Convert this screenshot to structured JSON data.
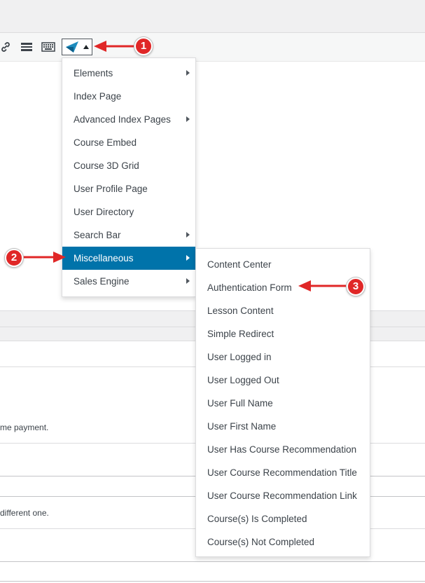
{
  "toolbar": {
    "icons": [
      "link-icon",
      "horizontal-rule-icon",
      "keyboard-icon",
      "plugin-logo-icon",
      "caret-up-icon"
    ]
  },
  "background": {
    "text_1": "me payment.",
    "text_2": "different one."
  },
  "menu": {
    "items": [
      {
        "label": "Elements",
        "submenu": true
      },
      {
        "label": "Index Page",
        "submenu": false
      },
      {
        "label": "Advanced Index Pages",
        "submenu": true
      },
      {
        "label": "Course Embed",
        "submenu": false
      },
      {
        "label": "Course 3D Grid",
        "submenu": false
      },
      {
        "label": "User Profile Page",
        "submenu": false
      },
      {
        "label": "User Directory",
        "submenu": false
      },
      {
        "label": "Search Bar",
        "submenu": true
      },
      {
        "label": "Miscellaneous",
        "submenu": true,
        "active": true
      },
      {
        "label": "Sales Engine",
        "submenu": true
      }
    ]
  },
  "submenu": {
    "items": [
      "Content Center",
      "Authentication Form",
      "Lesson Content",
      "Simple Redirect",
      "User Logged in",
      "User Logged Out",
      "User Full Name",
      "User First Name",
      "User Has Course Recommendation",
      "User Course Recommendation Title",
      "User Course Recommendation Link",
      "Course(s) Is Completed",
      "Course(s) Not Completed"
    ]
  },
  "annotations": {
    "badge_1": "1",
    "badge_2": "2",
    "badge_3": "3",
    "color": "#e02727"
  },
  "colors": {
    "active_bg": "#0073aa",
    "plugin_logo": "#1e8cbe"
  }
}
